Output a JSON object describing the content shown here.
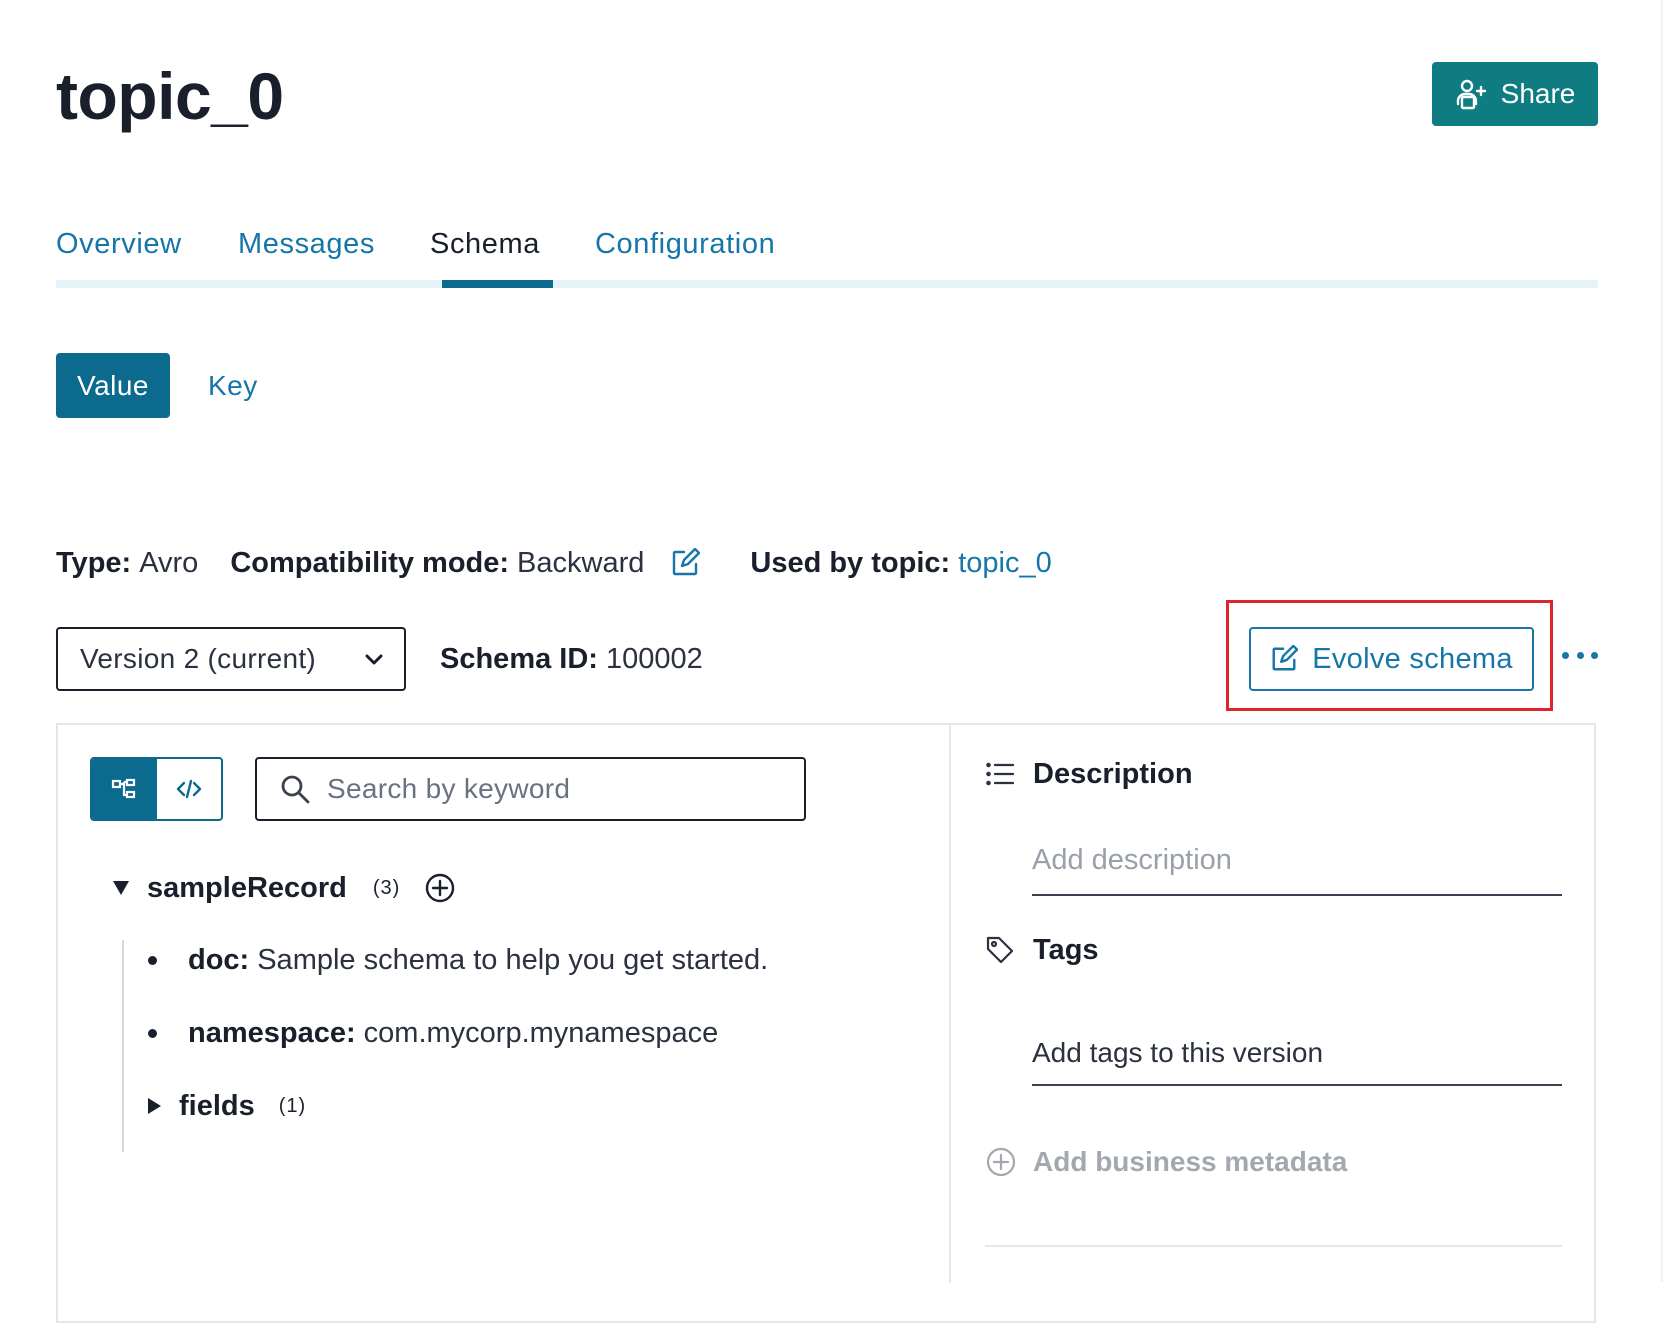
{
  "page": {
    "title": "topic_0",
    "share_label": "Share"
  },
  "tabs": [
    {
      "label": "Overview",
      "active": false
    },
    {
      "label": "Messages",
      "active": false
    },
    {
      "label": "Schema",
      "active": true
    },
    {
      "label": "Configuration",
      "active": false
    }
  ],
  "schema_switch": {
    "value_label": "Value",
    "key_label": "Key",
    "selected": "Value"
  },
  "meta": {
    "type_label": "Type:",
    "type_value": "Avro",
    "compat_label": "Compatibility mode:",
    "compat_value": "Backward",
    "used_by_label": "Used by topic:",
    "used_by_value": "topic_0"
  },
  "version": {
    "selected": "Version 2 (current)",
    "schema_id_label": "Schema ID:",
    "schema_id_value": "100002"
  },
  "actions": {
    "evolve_label": "Evolve schema"
  },
  "search": {
    "placeholder": "Search by keyword",
    "value": ""
  },
  "tree": {
    "root_name": "sampleRecord",
    "root_count": "(3)",
    "doc_key": "doc:",
    "doc_value": "Sample schema to help you get started.",
    "namespace_key": "namespace:",
    "namespace_value": "com.mycorp.mynamespace",
    "fields_name": "fields",
    "fields_count": "(1)"
  },
  "sidebar": {
    "description_title": "Description",
    "description_placeholder": "Add description",
    "tags_title": "Tags",
    "tags_placeholder": "Add tags to this version",
    "add_metadata_label": "Add business metadata"
  },
  "colors": {
    "primary": "#0b6a8e",
    "share_button": "#0e7c80",
    "link": "#1676a8",
    "highlight": "#e0242b",
    "text": "#1a1f2c"
  },
  "icons": {
    "share": "share-person-icon",
    "edit": "edit-square-icon",
    "chevron": "chevron-down-icon",
    "more": "more-horizontal-icon",
    "tree_view": "tree-view-icon",
    "code_view": "code-icon",
    "search": "search-icon",
    "add": "plus-circle-icon",
    "description": "list-icon",
    "tags": "tag-icon"
  }
}
